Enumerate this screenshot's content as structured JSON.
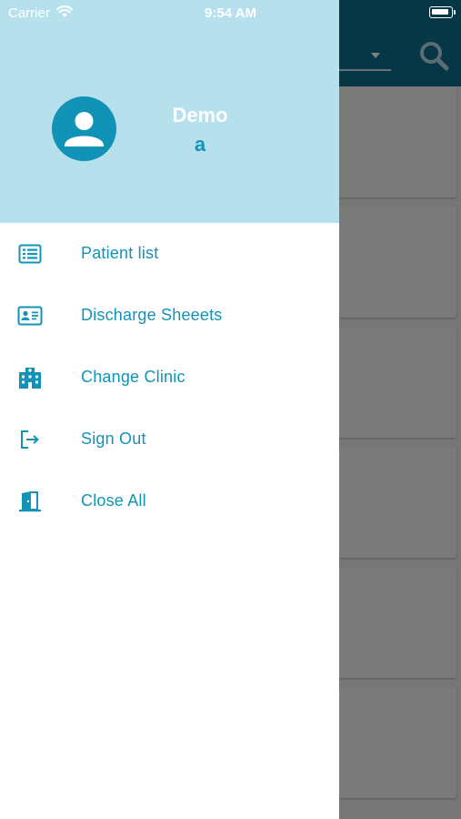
{
  "status_bar": {
    "carrier": "Carrier",
    "time": "9:54 AM"
  },
  "user": {
    "name": "Demo",
    "subtitle": "a"
  },
  "menu": [
    {
      "label": "Patient list",
      "icon": "list-icon"
    },
    {
      "label": "Discharge Sheeets",
      "icon": "id-card-icon"
    },
    {
      "label": "Change Clinic",
      "icon": "building-icon"
    },
    {
      "label": "Sign Out",
      "icon": "sign-out-icon"
    },
    {
      "label": "Close All",
      "icon": "door-icon"
    }
  ],
  "colors": {
    "accent": "#1193b7",
    "drawer_header": "#b6e0ec",
    "app_header": "#0a6f8c",
    "overlay": "rgba(0,0,0,0.5)"
  }
}
